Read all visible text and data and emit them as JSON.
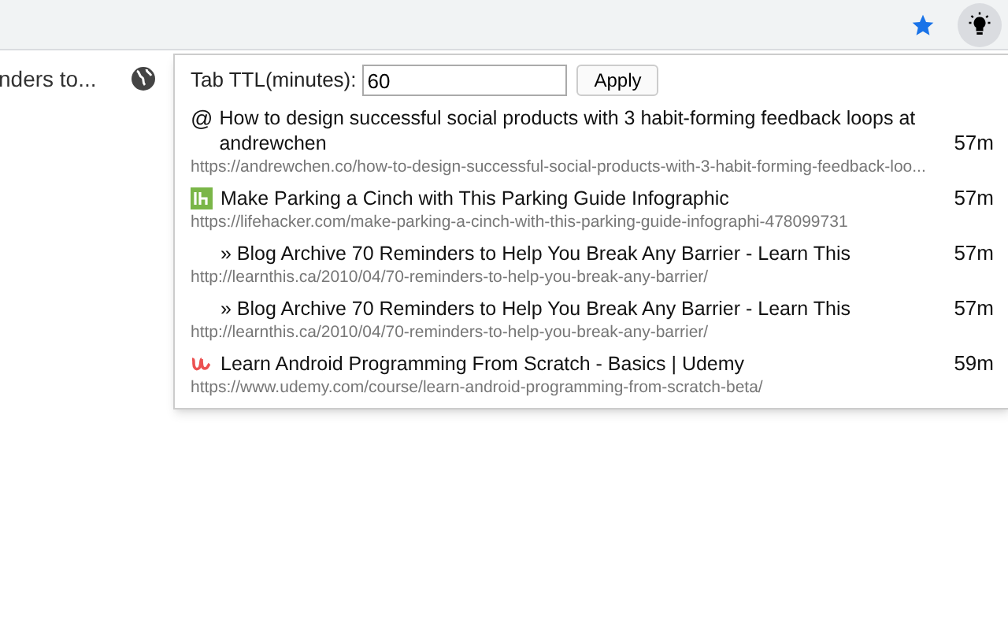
{
  "background_tab": {
    "title": "nders to..."
  },
  "popup": {
    "ttl_label": "Tab TTL(minutes):",
    "ttl_value": "60",
    "apply_button": "Apply",
    "items": [
      {
        "kind": "glyph",
        "icon_text": "@",
        "title": "How to design successful social products with 3 habit-forming feedback loops at andrewchen",
        "url": "https://andrewchen.co/how-to-design-successful-social-products-with-3-habit-forming-feedback-loo...",
        "age": "57m"
      },
      {
        "kind": "square-logo",
        "title": "Make Parking a Cinch with This Parking Guide Infographic",
        "url": "https://lifehacker.com/make-parking-a-cinch-with-this-parking-guide-infographi-478099731",
        "age": "57m"
      },
      {
        "kind": "plain",
        "title": "» Blog Archive 70 Reminders to Help You Break Any Barrier - Learn This",
        "url": "http://learnthis.ca/2010/04/70-reminders-to-help-you-break-any-barrier/",
        "age": "57m"
      },
      {
        "kind": "plain",
        "title": "» Blog Archive 70 Reminders to Help You Break Any Barrier - Learn This",
        "url": "http://learnthis.ca/2010/04/70-reminders-to-help-you-break-any-barrier/",
        "age": "57m"
      },
      {
        "kind": "script-logo",
        "title": "Learn Android Programming From Scratch - Basics | Udemy",
        "url": "https://www.udemy.com/course/learn-android-programming-from-scratch-beta/",
        "age": "59m"
      }
    ]
  }
}
